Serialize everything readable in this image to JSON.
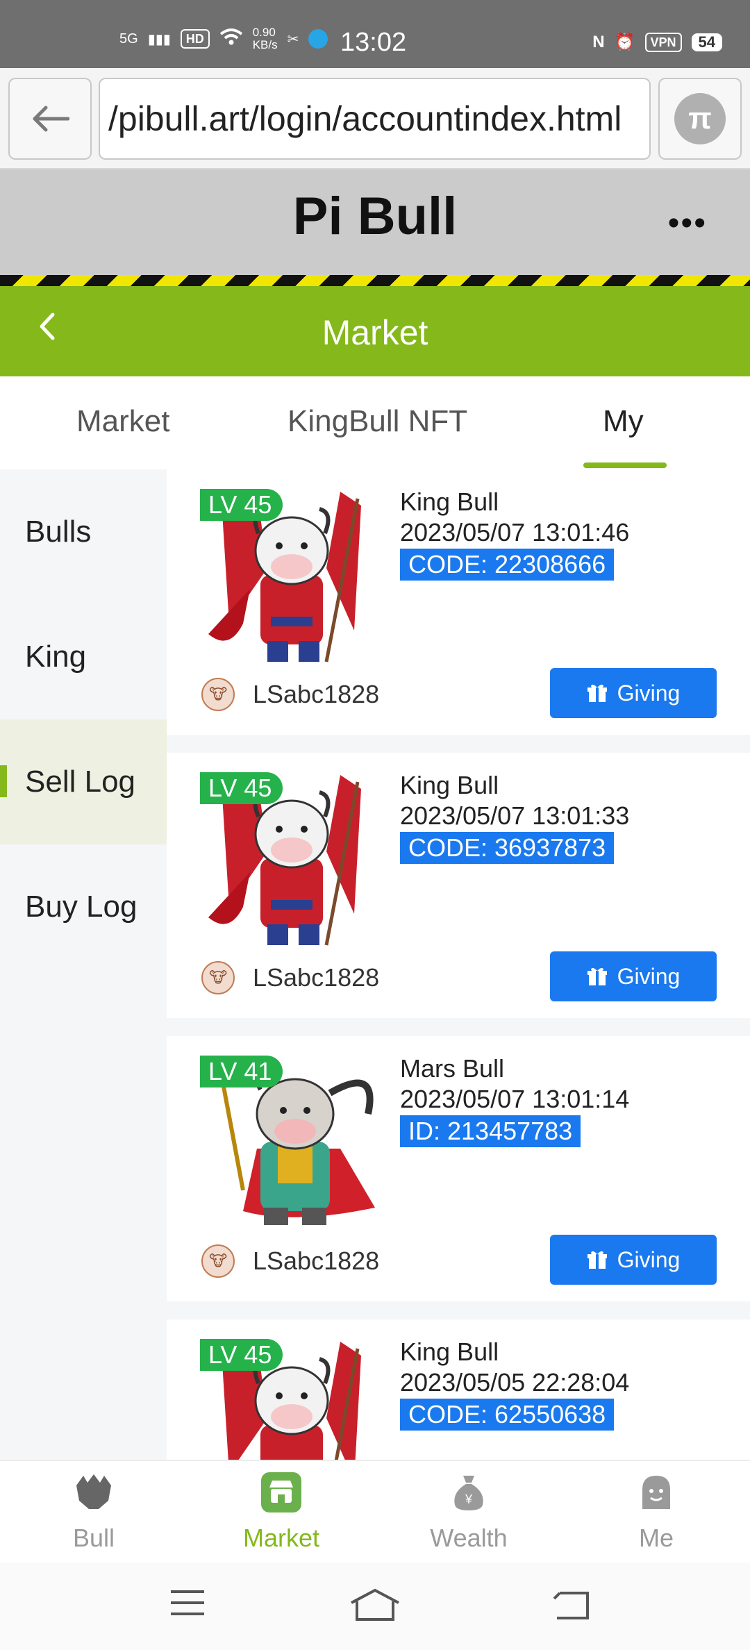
{
  "status_bar": {
    "network": "5G",
    "hd": "HD",
    "speed": "0.90",
    "speed_unit": "KB/s",
    "time": "13:02",
    "vpn": "VPN",
    "battery": "54"
  },
  "browser": {
    "url": "/pibull.art/login/accountindex.html"
  },
  "header": {
    "title": "Pi Bull",
    "more": "•••"
  },
  "market_bar": {
    "title": "Market"
  },
  "tabs": [
    {
      "label": "Market"
    },
    {
      "label": "KingBull NFT"
    },
    {
      "label": "My"
    }
  ],
  "sidebar": {
    "items": [
      {
        "label": "Bulls"
      },
      {
        "label": "King"
      },
      {
        "label": "Sell Log"
      },
      {
        "label": "Buy Log"
      }
    ]
  },
  "cards": [
    {
      "level": "LV 45",
      "name": "King Bull",
      "datetime": "2023/05/07 13:01:46",
      "code": "CODE: 22308666",
      "owner": "LSabc1828",
      "action": "Giving"
    },
    {
      "level": "LV 45",
      "name": "King Bull",
      "datetime": "2023/05/07 13:01:33",
      "code": "CODE: 36937873",
      "owner": "LSabc1828",
      "action": "Giving"
    },
    {
      "level": "LV 41",
      "name": "Mars Bull",
      "datetime": "2023/05/07 13:01:14",
      "code": "ID: 213457783",
      "owner": "LSabc1828",
      "action": "Giving"
    },
    {
      "level": "LV 45",
      "name": "King Bull",
      "datetime": "2023/05/05 22:28:04",
      "code": "CODE: 62550638"
    }
  ],
  "bottom_nav": [
    {
      "label": "Bull",
      "icon": "bull-icon"
    },
    {
      "label": "Market",
      "icon": "market-icon"
    },
    {
      "label": "Wealth",
      "icon": "wealth-icon"
    },
    {
      "label": "Me",
      "icon": "me-icon"
    }
  ],
  "colors": {
    "accent": "#84b81b",
    "button_blue": "#1a79ee",
    "level_green": "#25b24a"
  }
}
